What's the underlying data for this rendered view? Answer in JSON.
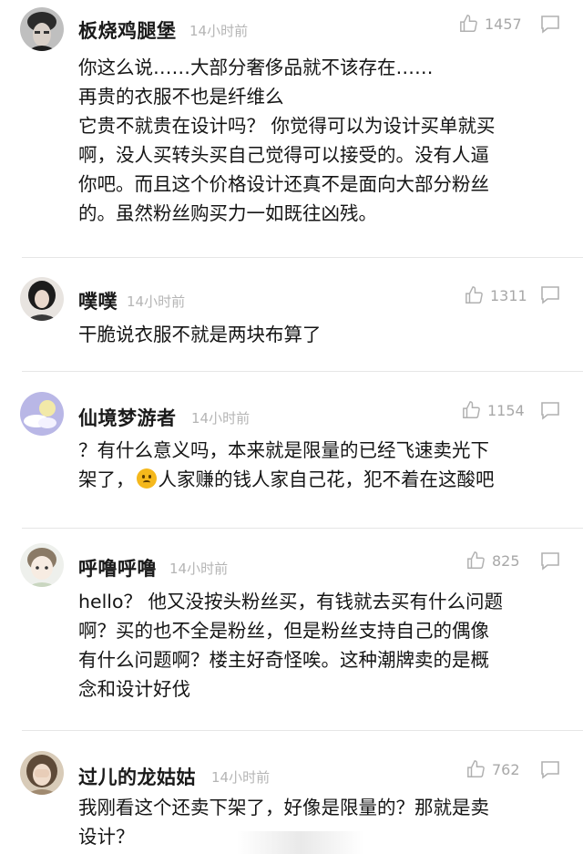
{
  "comments": [
    {
      "username": "板烧鸡腿堡",
      "time": "14小时前",
      "likes": "1457",
      "lines": [
        "你这么说……大部分奢侈品就不该存在……",
        "再贵的衣服不也是纤维么",
        "它贵不就贵在设计吗？ 你觉得可以为设计买单就买",
        "啊，没人买转头买自己觉得可以接受的。没有人逼",
        "你吧。而且这个价格设计还真不是面向大部分粉丝",
        "的。虽然粉丝购买力一如既往凶残。"
      ]
    },
    {
      "username": "噗噗",
      "time": "14小时前",
      "likes": "1311",
      "lines": [
        "干脆说衣服不就是两块布算了"
      ]
    },
    {
      "username": "仙境梦游者",
      "time": "14小时前",
      "likes": "1154",
      "lines": [
        "？有什么意义吗，本来就是限量的已经飞速卖光下"
      ],
      "line2_before": "架了，",
      "line2_after": "人家赚的钱人家自己花，犯不着在这酸吧"
    },
    {
      "username": "呼噜呼噜",
      "time": "14小时前",
      "likes": "825",
      "lines": [
        "hello？ 他又没按头粉丝买，有钱就去买有什么问题",
        "啊？买的也不全是粉丝，但是粉丝支持自己的偶像",
        "有什么问题啊？楼主好奇怪唉。这种潮牌卖的是概",
        "念和设计好伐"
      ]
    },
    {
      "username": "过儿的龙姑姑",
      "time": "14小时前",
      "likes": "762",
      "lines": [
        "我刚看这个还卖下架了，好像是限量的？那就是卖",
        "设计？"
      ]
    }
  ]
}
